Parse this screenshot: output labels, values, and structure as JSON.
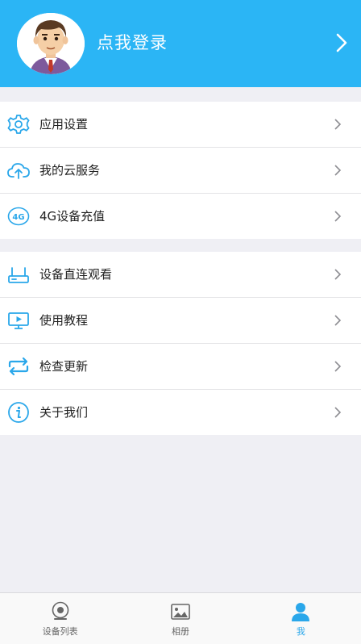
{
  "header": {
    "login_label": "点我登录",
    "avatar_icon": "cartoon-boy-avatar",
    "chevron_icon": "chevron-right-icon"
  },
  "colors": {
    "accent": "#2bb5f5",
    "icon_blue": "#2aa7ea",
    "background": "#efeff4"
  },
  "menu_group1": [
    {
      "label": "应用设置",
      "icon": "gear-icon"
    },
    {
      "label": "我的云服务",
      "icon": "cloud-upload-icon"
    },
    {
      "label": "4G设备充值",
      "icon": "4g-icon"
    }
  ],
  "menu_group2": [
    {
      "label": "设备直连观看",
      "icon": "router-icon"
    },
    {
      "label": "使用教程",
      "icon": "video-tutorial-icon"
    },
    {
      "label": "检查更新",
      "icon": "refresh-arrows-icon"
    },
    {
      "label": "关于我们",
      "icon": "info-icon"
    }
  ],
  "tabbar": [
    {
      "label": "设备列表",
      "icon": "camera-icon",
      "active": false
    },
    {
      "label": "相册",
      "icon": "album-icon",
      "active": false
    },
    {
      "label": "我",
      "icon": "person-icon",
      "active": true
    }
  ]
}
